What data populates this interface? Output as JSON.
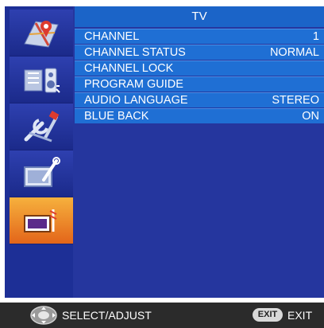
{
  "sidebar": {
    "tabs": [
      {
        "icon": "map-pin-icon",
        "active": false
      },
      {
        "icon": "audio-equalizer-icon",
        "active": false
      },
      {
        "icon": "tools-icon",
        "active": false
      },
      {
        "icon": "tv-wrench-icon",
        "active": false
      },
      {
        "icon": "tv-antenna-icon",
        "active": true
      }
    ]
  },
  "menu": {
    "title": "TV",
    "items": [
      {
        "label": "CHANNEL",
        "value": "1"
      },
      {
        "label": "CHANNEL STATUS",
        "value": "NORMAL"
      },
      {
        "label": "CHANNEL LOCK",
        "value": ""
      },
      {
        "label": "PROGRAM GUIDE",
        "value": ""
      },
      {
        "label": "AUDIO LANGUAGE",
        "value": "STEREO"
      },
      {
        "label": "BLUE BACK",
        "value": "ON"
      }
    ]
  },
  "footer": {
    "select_label": "SELECT/ADJUST",
    "exit_key": "EXIT",
    "exit_label": "EXIT"
  },
  "colors": {
    "panel": "#25369e",
    "row": "#1f6fd4",
    "active_tab": "#f08a2a"
  }
}
